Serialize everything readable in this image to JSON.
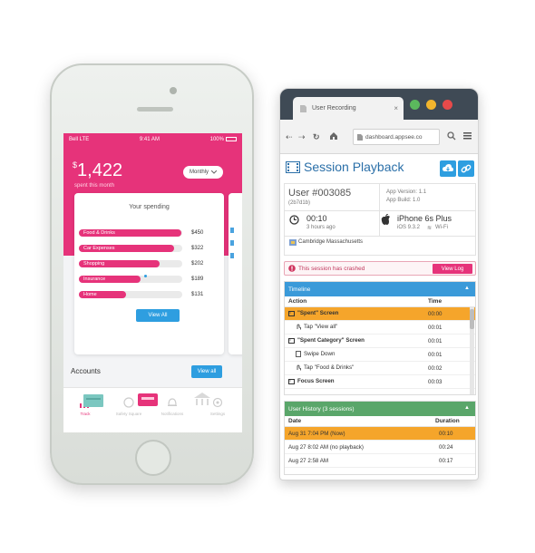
{
  "phone": {
    "status": {
      "carrier": "Bell LTE",
      "time": "9:41 AM",
      "battery": "100%"
    },
    "balance": {
      "currency": "$",
      "amount": "1,422",
      "subtitle": "spent this month"
    },
    "period_select": "Monthly",
    "spending_title": "Your spending",
    "spending": [
      {
        "label": "Food & Drinks",
        "amount": "$450",
        "fraction": 0.99
      },
      {
        "label": "Car Expenses",
        "amount": "$322",
        "fraction": 0.92
      },
      {
        "label": "Shopping",
        "amount": "$202",
        "fraction": 0.78
      },
      {
        "label": "Insurance",
        "amount": "$189",
        "fraction": 0.6
      },
      {
        "label": "Home",
        "amount": "$131",
        "fraction": 0.46
      }
    ],
    "view_all": "View All",
    "accounts_title": "Accounts",
    "accounts_view_all": "View all",
    "tabs": [
      {
        "label": "Track"
      },
      {
        "label": "Safety Square"
      },
      {
        "label": "Notifications"
      },
      {
        "label": "Settings"
      }
    ],
    "colors": {
      "accent": "#e6337a",
      "button": "#2e9ee0"
    }
  },
  "browser": {
    "tab_title": "User Recording",
    "url": "dashboard.appsee.co",
    "page_title": "Session Playback",
    "user_id": "User #003085",
    "user_hash": "(2b7d1b)",
    "app_version": "App Version: 1.1",
    "app_build": "App Build: 1.0",
    "duration": "00:10",
    "time_ago": "3 hours ago",
    "device": "iPhone 6s Plus",
    "os": "iOS 9.3.2",
    "network": "Wi-Fi",
    "location": "Cambridge Massachusetts",
    "crash_message": "This session has crashed",
    "view_log": "View Log",
    "timeline": {
      "title": "Timeline",
      "col_action": "Action",
      "col_time": "Time",
      "rows": [
        {
          "action": "\"Spent\" Screen",
          "time": "00:00",
          "kind": "screen",
          "highlight": true
        },
        {
          "action": "Tap \"View all\"",
          "time": "00:01",
          "kind": "tap",
          "highlight": false
        },
        {
          "action": "\"Spent Category\" Screen",
          "time": "00:01",
          "kind": "screen",
          "highlight": false
        },
        {
          "action": "Swipe Down",
          "time": "00:01",
          "kind": "swipe",
          "highlight": false
        },
        {
          "action": "Tap \"Food & Drinks\"",
          "time": "00:02",
          "kind": "tap",
          "highlight": false
        },
        {
          "action": "Focus Screen",
          "time": "00:03",
          "kind": "screen",
          "highlight": false
        }
      ]
    },
    "history": {
      "title": "User History (3 sessions)",
      "col_date": "Date",
      "col_duration": "Duration",
      "rows": [
        {
          "date": "Aug 31 7:04 PM (Now)",
          "duration": "00:10",
          "highlight": true
        },
        {
          "date": "Aug 27 8:02 AM (no playback)",
          "duration": "00:24",
          "highlight": false
        },
        {
          "date": "Aug 27 2:58 AM",
          "duration": "00:17",
          "highlight": false
        }
      ]
    },
    "colors": {
      "timeline_header": "#3a9ad9",
      "history_header": "#5aa66a",
      "highlight": "#f5a52b",
      "title_blue": "#2a6fa8"
    }
  }
}
